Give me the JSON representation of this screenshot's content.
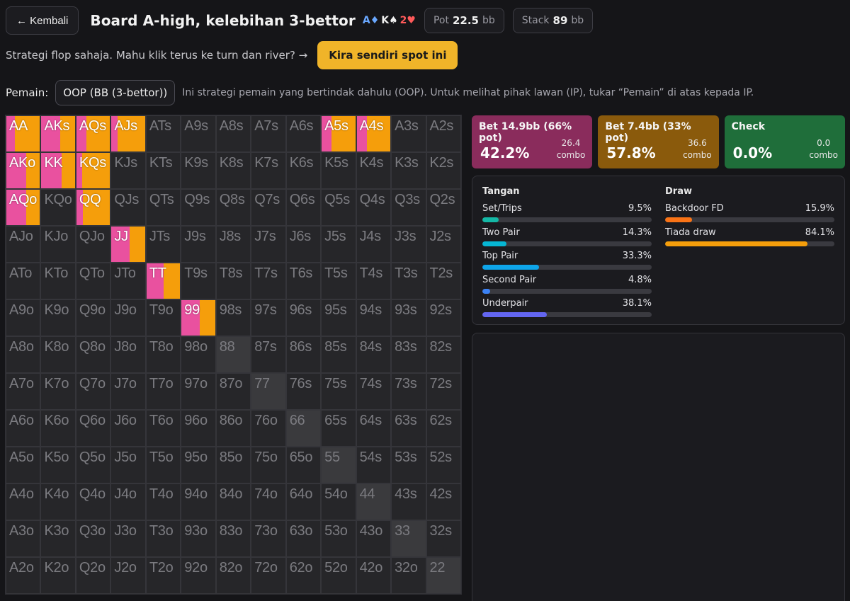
{
  "header": {
    "back_label": "← Kembali",
    "title": "Board A-high, kelebihan 3-bettor",
    "board": [
      {
        "text": "A♦",
        "color": "#6aa8ff"
      },
      {
        "text": "K♠",
        "color": "#f0f0f0"
      },
      {
        "text": "2♥",
        "color": "#ff5a5a"
      }
    ],
    "pot": {
      "label": "Pot",
      "value": "22.5",
      "unit": "bb"
    },
    "stack": {
      "label": "Stack",
      "value": "89",
      "unit": "bb"
    }
  },
  "intro": {
    "text": "Strategi flop sahaja. Mahu klik terus ke turn dan river? →",
    "button_label": "Kira sendiri spot ini"
  },
  "player": {
    "label": "Pemain:",
    "selected": "OOP (BB (3-bettor))",
    "note": "Ini strategi pemain yang bertindak dahulu (OOP). Untuk melihat pihak lawan (IP), tukar “Pemain” di atas kepada IP."
  },
  "colors": {
    "bet_big": "#e9519f",
    "bet_small": "#f59e0b",
    "check": "#22a34a"
  },
  "range": {
    "ranks": [
      "A",
      "K",
      "Q",
      "J",
      "T",
      "9",
      "8",
      "7",
      "6",
      "5",
      "4",
      "3",
      "2"
    ],
    "grid": [
      [
        "AA",
        "AKs",
        "AQs",
        "AJs",
        "ATs",
        "A9s",
        "A8s",
        "A7s",
        "A6s",
        "A5s",
        "A4s",
        "A3s",
        "A2s"
      ],
      [
        "AKo",
        "KK",
        "KQs",
        "KJs",
        "KTs",
        "K9s",
        "K8s",
        "K7s",
        "K6s",
        "K5s",
        "K4s",
        "K3s",
        "K2s"
      ],
      [
        "AQo",
        "KQo",
        "QQ",
        "QJs",
        "QTs",
        "Q9s",
        "Q8s",
        "Q7s",
        "Q6s",
        "Q5s",
        "Q4s",
        "Q3s",
        "Q2s"
      ],
      [
        "AJo",
        "KJo",
        "QJo",
        "JJ",
        "JTs",
        "J9s",
        "J8s",
        "J7s",
        "J6s",
        "J5s",
        "J4s",
        "J3s",
        "J2s"
      ],
      [
        "ATo",
        "KTo",
        "QTo",
        "JTo",
        "TT",
        "T9s",
        "T8s",
        "T7s",
        "T6s",
        "T5s",
        "T4s",
        "T3s",
        "T2s"
      ],
      [
        "A9o",
        "K9o",
        "Q9o",
        "J9o",
        "T9o",
        "99",
        "98s",
        "97s",
        "96s",
        "95s",
        "94s",
        "93s",
        "92s"
      ],
      [
        "A8o",
        "K8o",
        "Q8o",
        "J8o",
        "T8o",
        "98o",
        "88",
        "87s",
        "86s",
        "85s",
        "84s",
        "83s",
        "82s"
      ],
      [
        "A7o",
        "K7o",
        "Q7o",
        "J7o",
        "T7o",
        "97o",
        "87o",
        "77",
        "76s",
        "75s",
        "74s",
        "73s",
        "72s"
      ],
      [
        "A6o",
        "K6o",
        "Q6o",
        "J6o",
        "T6o",
        "96o",
        "86o",
        "76o",
        "66",
        "65s",
        "64s",
        "63s",
        "62s"
      ],
      [
        "A5o",
        "K5o",
        "Q5o",
        "J5o",
        "T5o",
        "95o",
        "85o",
        "75o",
        "65o",
        "55",
        "54s",
        "53s",
        "52s"
      ],
      [
        "A4o",
        "K4o",
        "Q4o",
        "J4o",
        "T4o",
        "94o",
        "84o",
        "74o",
        "64o",
        "54o",
        "44",
        "43s",
        "42s"
      ],
      [
        "A3o",
        "K3o",
        "Q3o",
        "J3o",
        "T3o",
        "93o",
        "83o",
        "73o",
        "63o",
        "53o",
        "43o",
        "33",
        "32s"
      ],
      [
        "A2o",
        "K2o",
        "Q2o",
        "J2o",
        "T2o",
        "92o",
        "82o",
        "72o",
        "62o",
        "52o",
        "42o",
        "32o",
        "22"
      ]
    ],
    "active": {
      "AA": {
        "bet_big": 0.25,
        "bet_small": 0.75
      },
      "AKs": {
        "bet_big": 0.55,
        "bet_small": 0.45
      },
      "AQs": {
        "bet_big": 0.3,
        "bet_small": 0.7
      },
      "AJs": {
        "bet_big": 0.18,
        "bet_small": 0.82
      },
      "A5s": {
        "bet_big": 0.3,
        "bet_small": 0.7
      },
      "A4s": {
        "bet_big": 0.3,
        "bet_small": 0.7
      },
      "AKo": {
        "bet_big": 0.6,
        "bet_small": 0.4
      },
      "KK": {
        "bet_big": 0.6,
        "bet_small": 0.4
      },
      "KQs": {
        "bet_big": 0.18,
        "bet_small": 0.82
      },
      "AQo": {
        "bet_big": 0.6,
        "bet_small": 0.4
      },
      "QQ": {
        "bet_big": 0.2,
        "bet_small": 0.8
      },
      "JJ": {
        "bet_big": 0.55,
        "bet_small": 0.45
      },
      "TT": {
        "bet_big": 0.5,
        "bet_small": 0.5
      },
      "99": {
        "bet_big": 0.55,
        "bet_small": 0.45
      }
    },
    "highlight_pairs": [
      "88",
      "77",
      "66",
      "55",
      "44",
      "33",
      "22"
    ]
  },
  "actions": [
    {
      "name": "Bet 14.9bb (66% pot)",
      "pct": "42.2%",
      "combo_value": "26.4",
      "combo_label": "combo",
      "color": "#8a2c5c"
    },
    {
      "name": "Bet 7.4bb (33% pot)",
      "pct": "57.8%",
      "combo_value": "36.6",
      "combo_label": "combo",
      "color": "#8a5a0c"
    },
    {
      "name": "Check",
      "pct": "0.0%",
      "combo_value": "0.0",
      "combo_label": "combo",
      "color": "#1f6e3a"
    }
  ],
  "breakdown": {
    "hands": {
      "title": "Tangan",
      "items": [
        {
          "label": "Set/Trips",
          "value": "9.5%",
          "fraction": 0.095,
          "color": "#14b8a6"
        },
        {
          "label": "Two Pair",
          "value": "14.3%",
          "fraction": 0.143,
          "color": "#06b6d4"
        },
        {
          "label": "Top Pair",
          "value": "33.3%",
          "fraction": 0.333,
          "color": "#0ea5e9"
        },
        {
          "label": "Second Pair",
          "value": "4.8%",
          "fraction": 0.048,
          "color": "#3b82f6"
        },
        {
          "label": "Underpair",
          "value": "38.1%",
          "fraction": 0.381,
          "color": "#6366f1"
        }
      ]
    },
    "draws": {
      "title": "Draw",
      "items": [
        {
          "label": "Backdoor FD",
          "value": "15.9%",
          "fraction": 0.159,
          "color": "#f97316"
        },
        {
          "label": "Tiada draw",
          "value": "84.1%",
          "fraction": 0.841,
          "color": "#f59e0b"
        }
      ]
    }
  }
}
